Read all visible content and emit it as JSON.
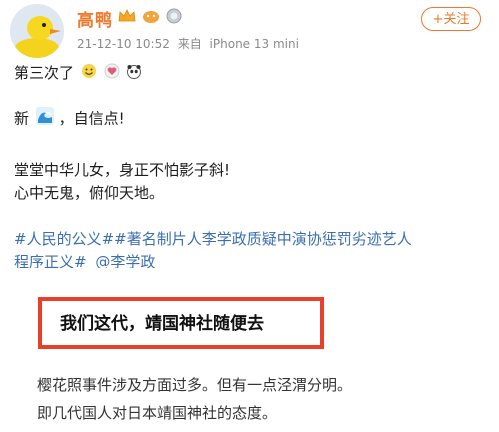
{
  "header": {
    "username": "高鸭",
    "timestamp": "21-12-10 10:52",
    "source_prefix": "来自",
    "device": "iPhone 13 mini",
    "follow_label": "+关注",
    "badges": [
      "crown-badge",
      "member-badge",
      "level-badge"
    ]
  },
  "post": {
    "line1": "第三次了",
    "line2_prefix": "新",
    "line2_suffix": "，自信点!",
    "line3": "堂堂中华儿女，身正不怕影子斜!",
    "line4": "心中无鬼，俯仰天地。",
    "tags_line1": "#人民的公义##著名制片人李学政质疑中演协惩罚劣迹艺人",
    "tags_line2_a": "程序正义#",
    "tags_line2_b": "@李学政"
  },
  "quote": {
    "headline": "我们这代，靖国神社随便去",
    "body_line1": "樱花照事件涉及方面过多。但有一点泾渭分明。",
    "body_line2": "即几代国人对日本靖国神社的态度。"
  },
  "colors": {
    "username": "#f0782a",
    "tag": "#3a6fb3",
    "highlight_border": "#e8402b"
  }
}
